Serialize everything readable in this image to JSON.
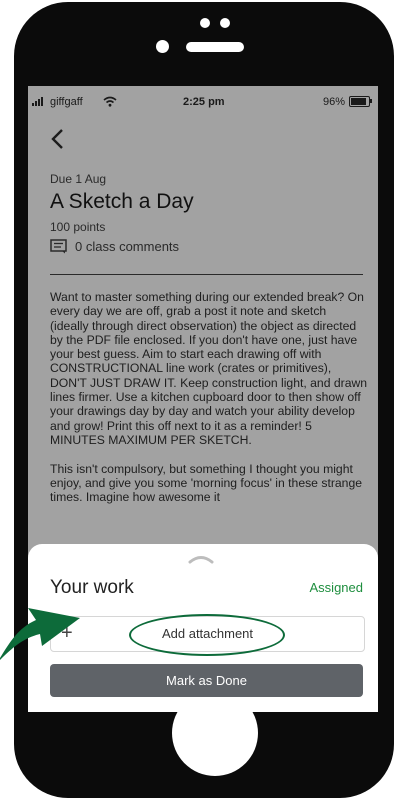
{
  "status_bar": {
    "carrier": "giffgaff",
    "time": "2:25 pm",
    "battery": "96%"
  },
  "nav": {
    "back_icon": "chevron-left-icon"
  },
  "assignment": {
    "due": "Due 1 Aug",
    "title": "A Sketch a Day",
    "points": "100 points",
    "comments": "0 class comments",
    "description": "Want to master something during our extended break? On every day we are off, grab a post it note and sketch (ideally through direct observation) the object as directed by the PDF file enclosed.  If you don't have one, just have your best guess.  Aim to start each drawing off with CONSTRUCTIONAL line work (crates or primitives), DON'T JUST DRAW IT.  Keep construction light, and drawn lines firmer. Use a kitchen cupboard door to then show off your drawings day by day and watch your ability develop and grow!  Print this off next to it as a reminder! 5 MINUTES MAXIMUM PER SKETCH.\n\nThis isn't compulsory, but something I thought you might enjoy, and give you some 'morning focus' in these strange times. Imagine how awesome it"
  },
  "your_work": {
    "heading": "Your work",
    "status": "Assigned",
    "add_attachment_label": "Add attachment",
    "mark_done_label": "Mark as Done"
  },
  "colors": {
    "assigned": "#1e8e3e",
    "highlight": "#0d6b3a",
    "button": "#5f6368"
  }
}
